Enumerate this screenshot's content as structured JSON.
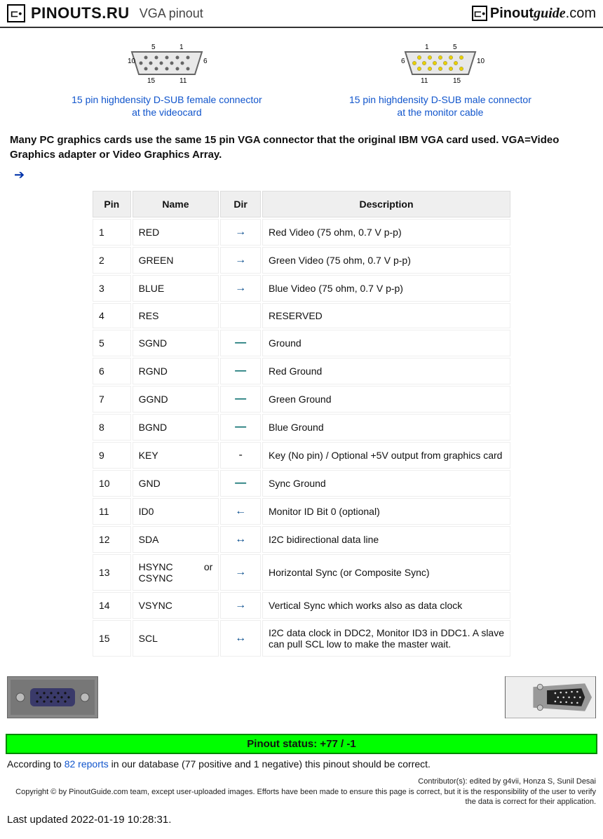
{
  "header": {
    "logo_left_text": "PINOUTS.RU",
    "page_title": "VGA pinout",
    "logo_right_pin": "Pinout",
    "logo_right_guide": "guide",
    "logo_right_dom": ".com"
  },
  "connectors": {
    "female": {
      "caption_l1": "15 pin highdensity D-SUB female connector",
      "caption_l2": "at the videocard",
      "n_5": "5",
      "n_1": "1",
      "n_6": "6",
      "n_10": "10",
      "n_11": "11",
      "n_15": "15"
    },
    "male": {
      "caption_l1": "15 pin highdensity D-SUB male connector",
      "caption_l2": "at the monitor cable",
      "n_1": "1",
      "n_5": "5",
      "n_6": "6",
      "n_10": "10",
      "n_11": "11",
      "n_15": "15"
    }
  },
  "intro": "Many PC graphics cards use the same 15 pin VGA connector that the original IBM VGA card used. VGA=Video Graphics adapter or Video Graphics Array.",
  "table": {
    "headers": {
      "pin": "Pin",
      "name": "Name",
      "dir": "Dir",
      "desc": "Description"
    },
    "rows": [
      {
        "pin": "1",
        "name": "RED",
        "dir": "out",
        "desc": "Red Video (75 ohm, 0.7 V p-p)"
      },
      {
        "pin": "2",
        "name": "GREEN",
        "dir": "out",
        "desc": "Green Video (75 ohm, 0.7 V p-p)"
      },
      {
        "pin": "3",
        "name": "BLUE",
        "dir": "out",
        "desc": "Blue Video (75 ohm, 0.7 V p-p)"
      },
      {
        "pin": "4",
        "name": "RES",
        "dir": "",
        "desc": "RESERVED"
      },
      {
        "pin": "5",
        "name": "SGND",
        "dir": "gnd",
        "desc": "Ground"
      },
      {
        "pin": "6",
        "name": "RGND",
        "dir": "gnd",
        "desc": "Red Ground"
      },
      {
        "pin": "7",
        "name": "GGND",
        "dir": "gnd",
        "desc": "Green Ground"
      },
      {
        "pin": "8",
        "name": "BGND",
        "dir": "gnd",
        "desc": "Blue Ground"
      },
      {
        "pin": "9",
        "name": "KEY",
        "dir": "-",
        "desc": "Key (No pin) / Optional +5V output from graphics card"
      },
      {
        "pin": "10",
        "name": "GND",
        "dir": "gnd",
        "desc": "Sync Ground"
      },
      {
        "pin": "11",
        "name": "ID0",
        "dir": "in",
        "desc": "Monitor ID Bit 0 (optional)"
      },
      {
        "pin": "12",
        "name": "SDA",
        "dir": "bi",
        "desc": "I2C bidirectional data line"
      },
      {
        "pin": "13",
        "name": "HSYNC or CSYNC",
        "dir": "out",
        "desc": "Horizontal Sync (or Composite Sync)"
      },
      {
        "pin": "14",
        "name": "VSYNC",
        "dir": "out",
        "desc": "Vertical Sync which works also as data clock"
      },
      {
        "pin": "15",
        "name": "SCL",
        "dir": "bi",
        "desc": "I2C data clock in DDC2, Monitor ID3 in DDC1. A slave can pull SCL low to make the master wait."
      }
    ]
  },
  "status": {
    "label": "Pinout status: +77 / -1"
  },
  "reports": {
    "pre": "According to ",
    "link": "82 reports",
    "post": " in our database (77 positive and 1 negative) this pinout should be correct."
  },
  "footer": {
    "contrib": "Contributor(s): edited by g4vii, Honza S, Sunil Desai",
    "copy": "Copyright © by PinoutGuide.com team, except user-uploaded images. Efforts have been made to ensure this page is correct, but it is the responsibility of the user to verify the data is correct for their application."
  },
  "updated": "Last updated 2022-01-19 10:28:31."
}
